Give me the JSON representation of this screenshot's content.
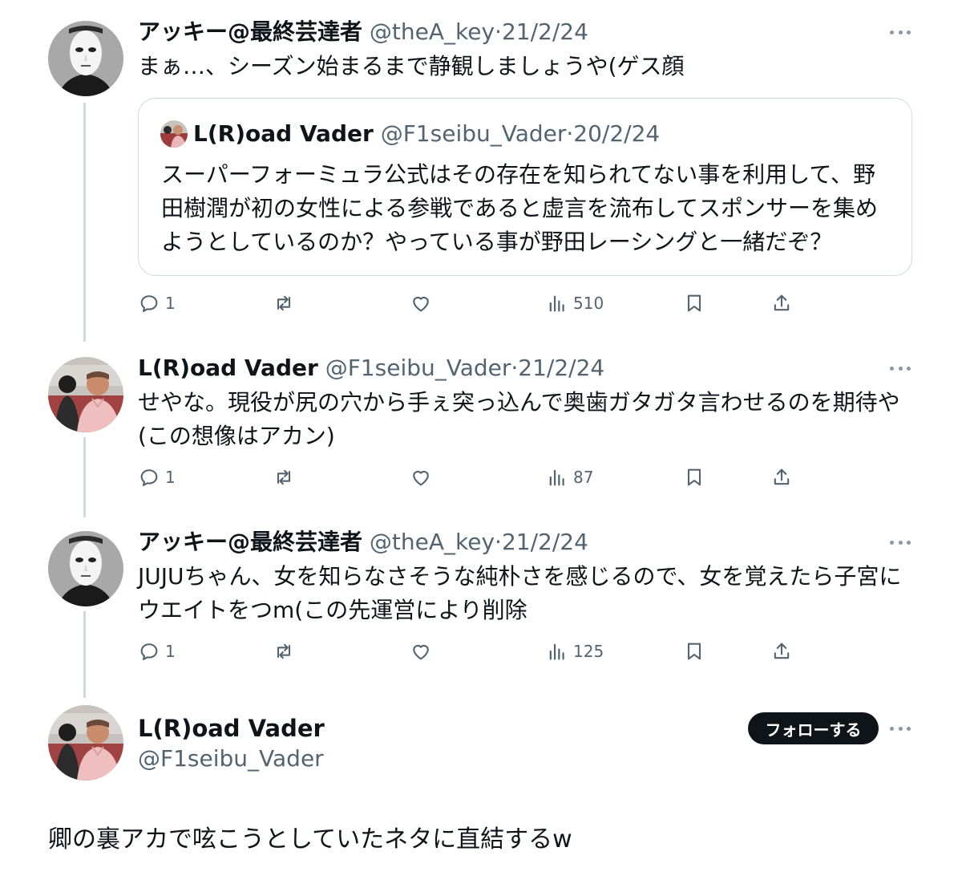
{
  "tweets": [
    {
      "name": "アッキー@最終芸達者",
      "handle": "@theA_key",
      "sep": "·",
      "date": "21/2/24",
      "text": "まぁ…、シーズン始まるまで静観しましょうや(ゲス顔",
      "quote": {
        "name": "L(R)oad Vader",
        "handle": "@F1seibu_Vader",
        "sep": "·",
        "date": "20/2/24",
        "text": "スーパーフォーミュラ公式はその存在を知られてない事を利用して、野田樹潤が初の女性による参戦であると虚言を流布してスポンサーを集めようとしているのか？やっている事が野田レーシングと一緒だぞ？"
      },
      "replies": "1",
      "views": "510"
    },
    {
      "name": "L(R)oad Vader",
      "handle": "@F1seibu_Vader",
      "sep": "·",
      "date": "21/2/24",
      "text": "せやな。現役が尻の穴から手ぇ突っ込んで奥歯ガタガタ言わせるのを期待や(この想像はアカン)",
      "replies": "1",
      "views": "87"
    },
    {
      "name": "アッキー@最終芸達者",
      "handle": "@theA_key",
      "sep": "·",
      "date": "21/2/24",
      "text": "JUJUちゃん、女を知らなさそうな純朴さを感じるので、女を覚えたら子宮にウエイトをつm(この先運営により削除",
      "replies": "1",
      "views": "125"
    }
  ],
  "main_tweet": {
    "name": "L(R)oad Vader",
    "handle": "@F1seibu_Vader",
    "follow_label": "フォローする",
    "text": "卿の裏アカで呟こうとしていたネタに直結するw"
  },
  "icons": [
    "reply-icon",
    "retweet-icon",
    "like-icon",
    "views-icon",
    "bookmark-icon",
    "share-icon",
    "more-icon"
  ],
  "colors": {
    "text": "#0f1419",
    "secondary": "#536471",
    "border": "#cfd9de",
    "follow_bg": "#0f1419"
  }
}
